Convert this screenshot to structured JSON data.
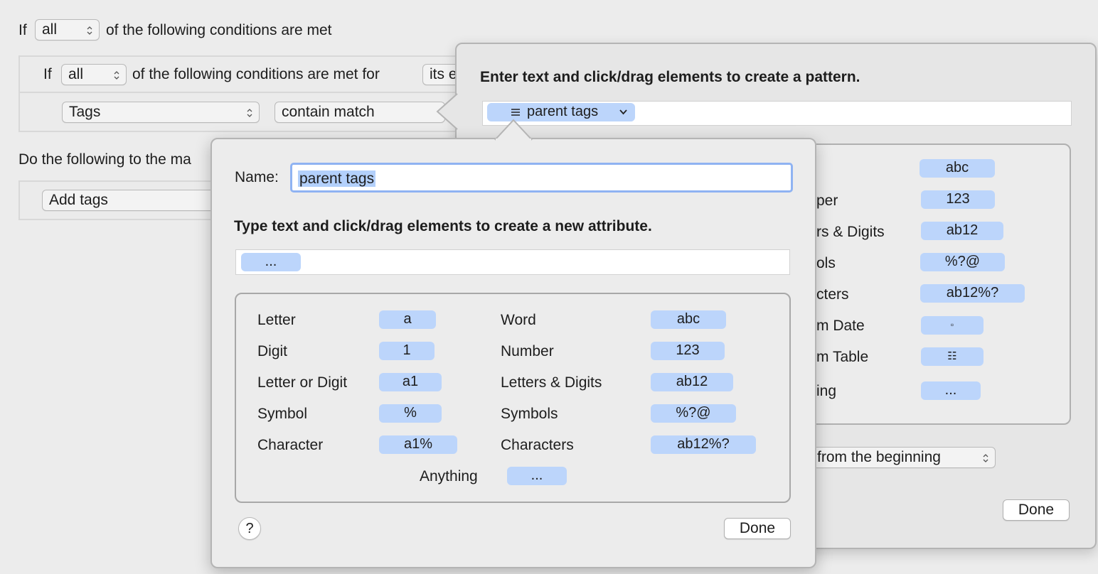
{
  "background": {
    "if_prefix": "If",
    "top_match_select": "all",
    "top_condition_suffix": "of the following conditions are met",
    "sub_if_prefix": "If",
    "sub_match_select": "all",
    "sub_condition_suffix": "of the following conditions are met for",
    "sub_scope_select": "its e",
    "attribute_select": "Tags",
    "operator_select": "contain match",
    "actions_heading": "Do the following to the ma",
    "action_select": "Add tags"
  },
  "pattern_sheet": {
    "instruction": "Enter text and click/drag elements to create a pattern.",
    "pattern_token_label": "parent tags",
    "pattern_token_icon": "list-icon",
    "partial_labels": [
      "",
      "per",
      "rs & Digits",
      "ols",
      "cters",
      "m Date",
      "m Table",
      "ing"
    ],
    "tokens": [
      "abc",
      "123",
      "ab12",
      "%?@",
      "ab12%?",
      "▫",
      "☷",
      "..."
    ],
    "match_mode_select": "from the beginning",
    "done_label": "Done"
  },
  "attribute_sheet": {
    "name_label": "Name:",
    "name_value": "parent tags",
    "instruction": "Type text and click/drag elements to create a new attribute.",
    "pattern_token": "...",
    "palette": {
      "left": [
        {
          "label": "Letter",
          "token": "a"
        },
        {
          "label": "Digit",
          "token": "1"
        },
        {
          "label": "Letter or Digit",
          "token": "a1"
        },
        {
          "label": "Symbol",
          "token": "%"
        },
        {
          "label": "Character",
          "token": "a1%"
        }
      ],
      "right": [
        {
          "label": "Word",
          "token": "abc"
        },
        {
          "label": "Number",
          "token": "123"
        },
        {
          "label": "Letters & Digits",
          "token": "ab12"
        },
        {
          "label": "Symbols",
          "token": "%?@"
        },
        {
          "label": "Characters",
          "token": "ab12%?"
        }
      ],
      "anything": {
        "label": "Anything",
        "token": "..."
      }
    },
    "help_label": "?",
    "done_label": "Done"
  },
  "colors": {
    "token_fill": "#bcd5fb",
    "focus_ring": "#8fb3f2",
    "selection": "#b3d0fb"
  }
}
